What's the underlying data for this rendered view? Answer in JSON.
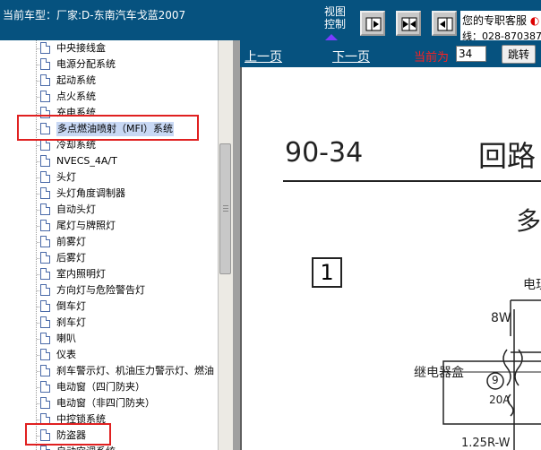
{
  "header": {
    "car_label": "当前车型：厂家:D-东南汽车戈蓝2007",
    "view_control": [
      "视图",
      "控制"
    ],
    "service_line1": "您的专职客服",
    "service_line2": "线：028-870387"
  },
  "tree": {
    "items": [
      {
        "label": "中央接线盒"
      },
      {
        "label": "电源分配系统"
      },
      {
        "label": "起动系统"
      },
      {
        "label": "点火系统"
      },
      {
        "label": "充电系统"
      },
      {
        "label": "多点燃油喷射（MFI）系统",
        "selected": true
      },
      {
        "label": "冷却系统"
      },
      {
        "label": "NVECS_4A/T"
      },
      {
        "label": "头灯"
      },
      {
        "label": "头灯角度调制器"
      },
      {
        "label": "自动头灯"
      },
      {
        "label": "尾灯与牌照灯"
      },
      {
        "label": "前雾灯"
      },
      {
        "label": "后雾灯"
      },
      {
        "label": "室内照明灯"
      },
      {
        "label": "方向灯与危险警告灯"
      },
      {
        "label": "倒车灯"
      },
      {
        "label": "刹车灯"
      },
      {
        "label": "喇叭"
      },
      {
        "label": "仪表"
      },
      {
        "label": "刹车警示灯、机油压力警示灯、燃油"
      },
      {
        "label": "电动窗（四门防夹）"
      },
      {
        "label": "电动窗（非四门防夹）"
      },
      {
        "label": "中控锁系统"
      },
      {
        "label": "防盗器"
      },
      {
        "label": "自动空调系统"
      }
    ]
  },
  "pager": {
    "prev": "上一页",
    "next": "下一页",
    "current_label": "当前为",
    "current_page": "34",
    "goto": "跳转"
  },
  "document": {
    "page_number": "90-34",
    "heading": "回路",
    "subheading": "多",
    "box_label": "1",
    "text_elec": "电现",
    "text_8w": "8W",
    "text_relay_box": "继电器盒",
    "text_9": "9",
    "text_20a": "20A",
    "text_wire": "1.25R-W"
  },
  "colors": {
    "header_bg": "#06527f",
    "highlight_border": "#e02020",
    "current_label": "#ff2020"
  }
}
